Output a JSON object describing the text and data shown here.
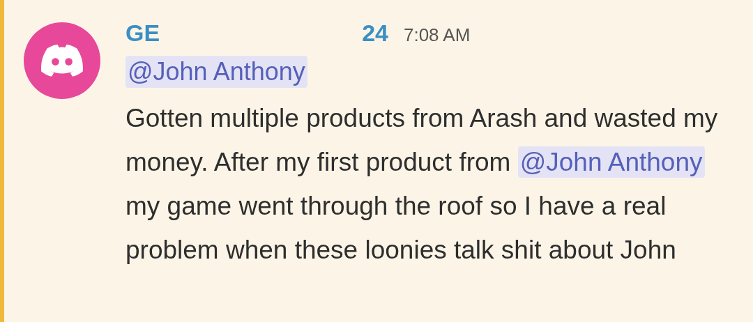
{
  "message": {
    "author_parts": [
      "GE",
      "24"
    ],
    "time": "7:08 AM",
    "reply_mention": "@John Anthony",
    "body": [
      {
        "kind": "text",
        "text": "Gotten multiple products from Arash and wasted my money. After my first product from "
      },
      {
        "kind": "mention",
        "text": "@John Anthony"
      },
      {
        "kind": "text",
        "text": " my game went through the roof so I have a real problem when these loonies talk shit about John"
      }
    ]
  }
}
